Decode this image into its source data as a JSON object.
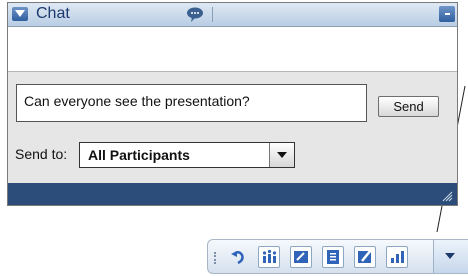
{
  "chat": {
    "title": "Chat",
    "message_input": "Can everyone see the presentation?",
    "send_label": "Send",
    "send_to_label": "Send to:",
    "send_to_value": "All Participants"
  },
  "colors": {
    "titlebar": "#c9d9ea",
    "statusbar": "#2c4d7a",
    "panel_bg": "#e6e6e6",
    "accent_blue": "#2f5f9e"
  },
  "toolbar": {
    "icons": [
      "undo-icon",
      "participants-icon",
      "whiteboard-icon",
      "notes-icon",
      "annotate-icon",
      "poll-icon",
      "more-arrow-icon"
    ]
  }
}
